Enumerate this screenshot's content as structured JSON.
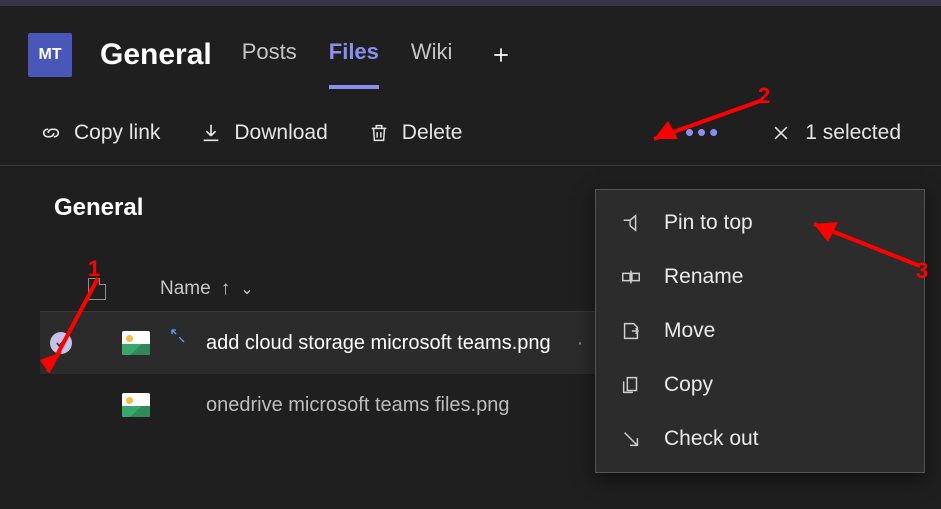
{
  "header": {
    "avatar_initials": "MT",
    "channel_title": "General",
    "tabs": [
      "Posts",
      "Files",
      "Wiki"
    ],
    "active_tab_index": 1
  },
  "toolbar": {
    "copy_link": "Copy link",
    "download": "Download",
    "delete": "Delete",
    "selected_label": "1 selected"
  },
  "content": {
    "folder_title": "General",
    "columns": {
      "name": "Name",
      "sort_arrow": "↑"
    },
    "files": [
      {
        "name": "add cloud storage microsoft teams.png",
        "selected": true,
        "is_new": true
      },
      {
        "name": "onedrive microsoft teams files.png",
        "selected": false,
        "is_new": false
      }
    ]
  },
  "context_menu": {
    "items": [
      {
        "icon": "pin",
        "label": "Pin to top"
      },
      {
        "icon": "rename",
        "label": "Rename"
      },
      {
        "icon": "move",
        "label": "Move"
      },
      {
        "icon": "copy",
        "label": "Copy"
      },
      {
        "icon": "checkout",
        "label": "Check out"
      }
    ]
  },
  "annotations": {
    "one": "1",
    "two": "2",
    "three": "3"
  }
}
